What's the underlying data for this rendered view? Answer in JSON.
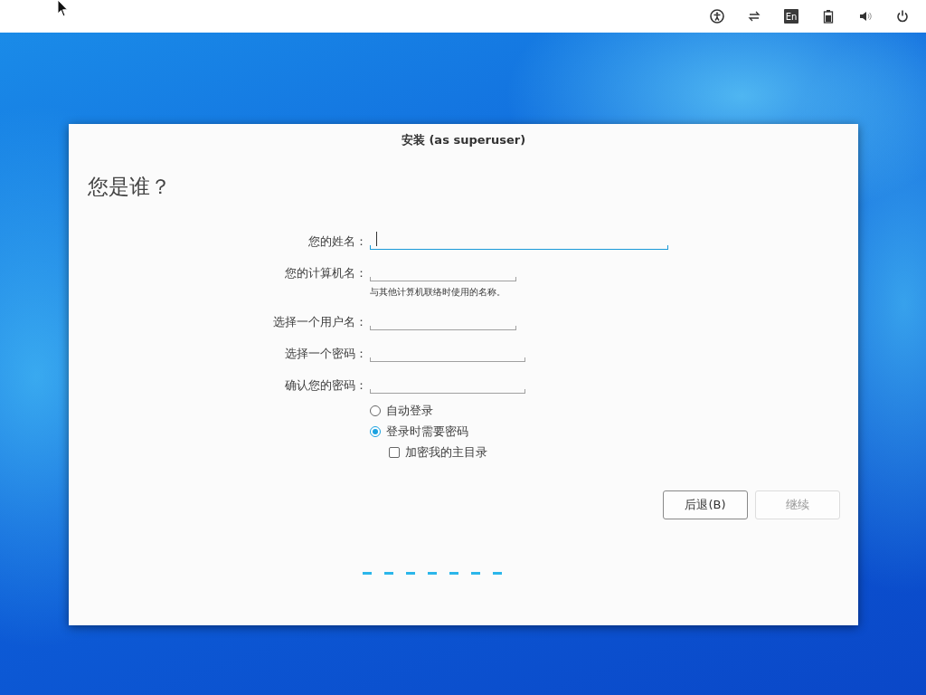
{
  "top_bar": {
    "keyboard_layout": "En"
  },
  "window": {
    "title": "安装 (as superuser)",
    "heading": "您是谁？",
    "fields": [
      {
        "kind": "full_name",
        "label": "您的姓名：",
        "focused": true
      },
      {
        "kind": "hostname",
        "label": "您的计算机名：",
        "focused": false,
        "hint": "与其他计算机联络时使用的名称。"
      },
      {
        "kind": "username",
        "label": "选择一个用户名：",
        "focused": false
      },
      {
        "kind": "password",
        "label": "选择一个密码：",
        "focused": false
      },
      {
        "kind": "password",
        "label": "确认您的密码：",
        "focused": false
      }
    ],
    "options": [
      {
        "kind": "radio",
        "label": "自动登录",
        "selected": false
      },
      {
        "kind": "radio",
        "label": "登录时需要密码",
        "selected": true
      },
      {
        "kind": "checkbox",
        "label": "加密我的主目录",
        "checked": false
      }
    ],
    "buttons": [
      {
        "label": "后退(B)",
        "disabled": false
      },
      {
        "label": "继续",
        "disabled": true
      }
    ]
  }
}
